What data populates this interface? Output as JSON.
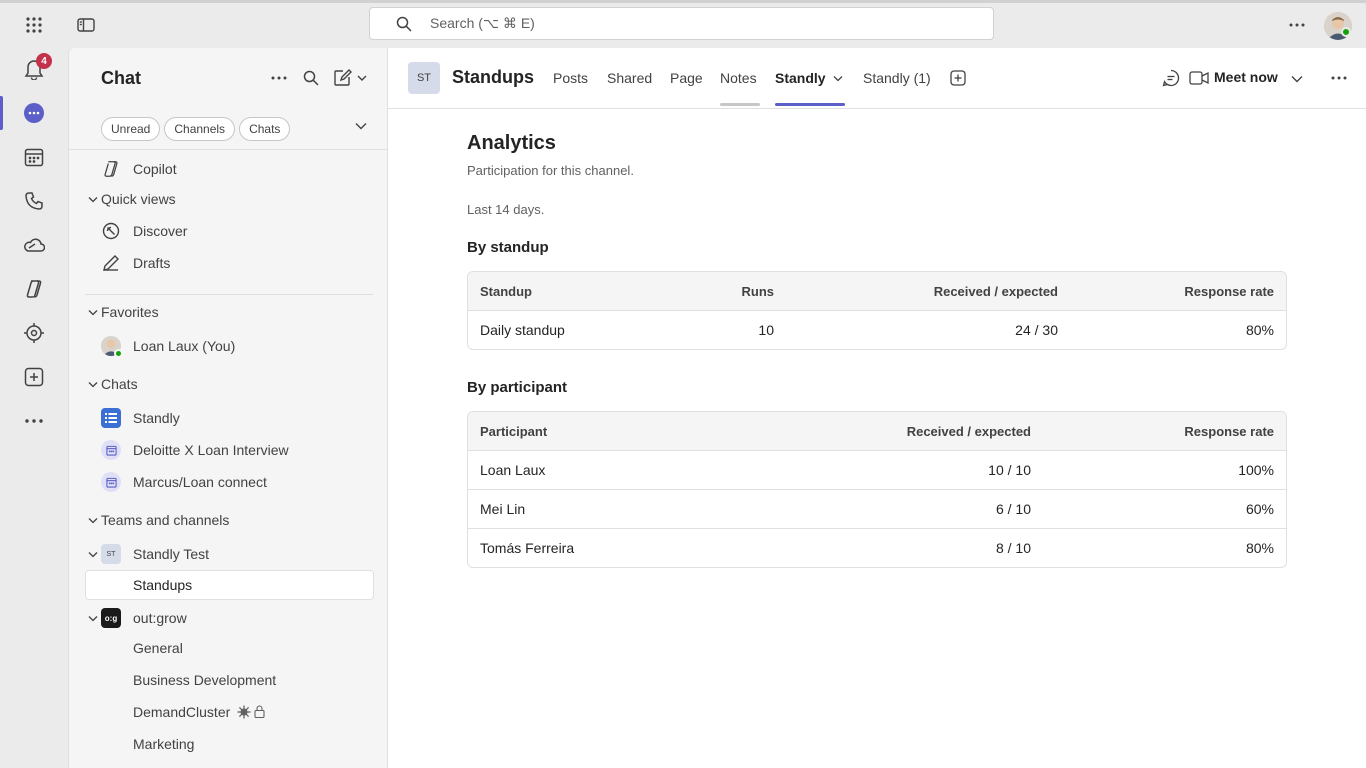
{
  "topbar": {
    "search_placeholder": "Search (⌥ ⌘ E)"
  },
  "rail": {
    "notifications_count": "4"
  },
  "sidebar": {
    "title": "Chat",
    "filters": [
      "Unread",
      "Channels",
      "Chats"
    ],
    "copilot": "Copilot",
    "quick_views": {
      "label": "Quick views",
      "items": [
        "Discover",
        "Drafts"
      ]
    },
    "favorites": {
      "label": "Favorites",
      "items": [
        "Loan Laux (You)"
      ]
    },
    "chats": {
      "label": "Chats",
      "items": [
        "Standly",
        "Deloitte X Loan Interview",
        "Marcus/Loan connect"
      ]
    },
    "teams": {
      "label": "Teams and channels",
      "team1": {
        "name": "Standly Test",
        "avatar": "ST",
        "channels": [
          "Standups"
        ]
      },
      "team2": {
        "name": "out:grow",
        "avatar": "o:g",
        "channels": [
          "General",
          "Business Development",
          "DemandCluster",
          "Marketing"
        ]
      }
    }
  },
  "channel": {
    "avatar": "ST",
    "name": "Standups",
    "tabs": [
      "Posts",
      "Shared",
      "Page",
      "Notes",
      "Standly",
      "Standly (1)"
    ],
    "meet_now": "Meet now"
  },
  "analytics": {
    "title": "Analytics",
    "subtitle": "Participation for this channel.",
    "range": "Last 14 days.",
    "by_standup": {
      "heading": "By standup",
      "columns": [
        "Standup",
        "Runs",
        "Received / expected",
        "Response rate"
      ],
      "rows": [
        [
          "Daily standup",
          "10",
          "24 / 30",
          "80%"
        ]
      ]
    },
    "by_participant": {
      "heading": "By participant",
      "columns": [
        "Participant",
        "Received / expected",
        "Response rate"
      ],
      "rows": [
        [
          "Loan Laux",
          "10 / 10",
          "100%"
        ],
        [
          "Mei Lin",
          "6 / 10",
          "60%"
        ],
        [
          "Tomás Ferreira",
          "8 / 10",
          "80%"
        ]
      ]
    }
  },
  "colors": {
    "accent": "#5b5fc7",
    "badge": "#c4314b",
    "presence": "#13a10e"
  }
}
